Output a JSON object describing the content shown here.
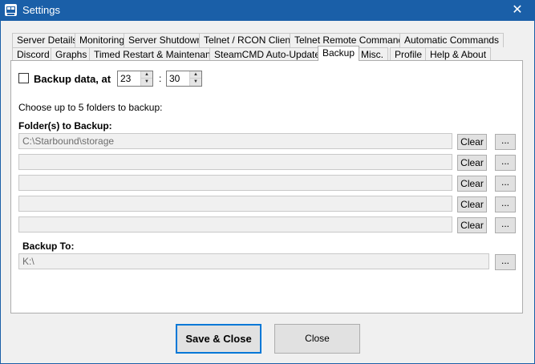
{
  "window": {
    "title": "Settings"
  },
  "tabs_row1": [
    "Server Details",
    "Monitoring",
    "Server Shutdown",
    "Telnet / RCON Client",
    "Telnet Remote Commands",
    "Automatic Commands"
  ],
  "tabs_row2": [
    "Discord",
    "Graphs",
    "Timed Restart & Maintenance",
    "SteamCMD Auto-Updates",
    "Backup",
    "Misc.",
    "Profile",
    "Help & About"
  ],
  "backup": {
    "enable_label": "Backup data, at",
    "enabled": false,
    "hour": "23",
    "time_separator": ":",
    "minute": "30",
    "instructions": "Choose up to 5 folders to backup:",
    "folders_label": "Folder(s) to Backup:",
    "folders": [
      "C:\\Starbound\\storage",
      "",
      "",
      "",
      ""
    ],
    "clear_label": "Clear",
    "browse_label": "...",
    "backup_to_label": "Backup To:",
    "backup_to": "K:\\"
  },
  "footer": {
    "save_label": "Save & Close",
    "close_label": "Close"
  },
  "icons": {
    "window_close": "✕"
  }
}
